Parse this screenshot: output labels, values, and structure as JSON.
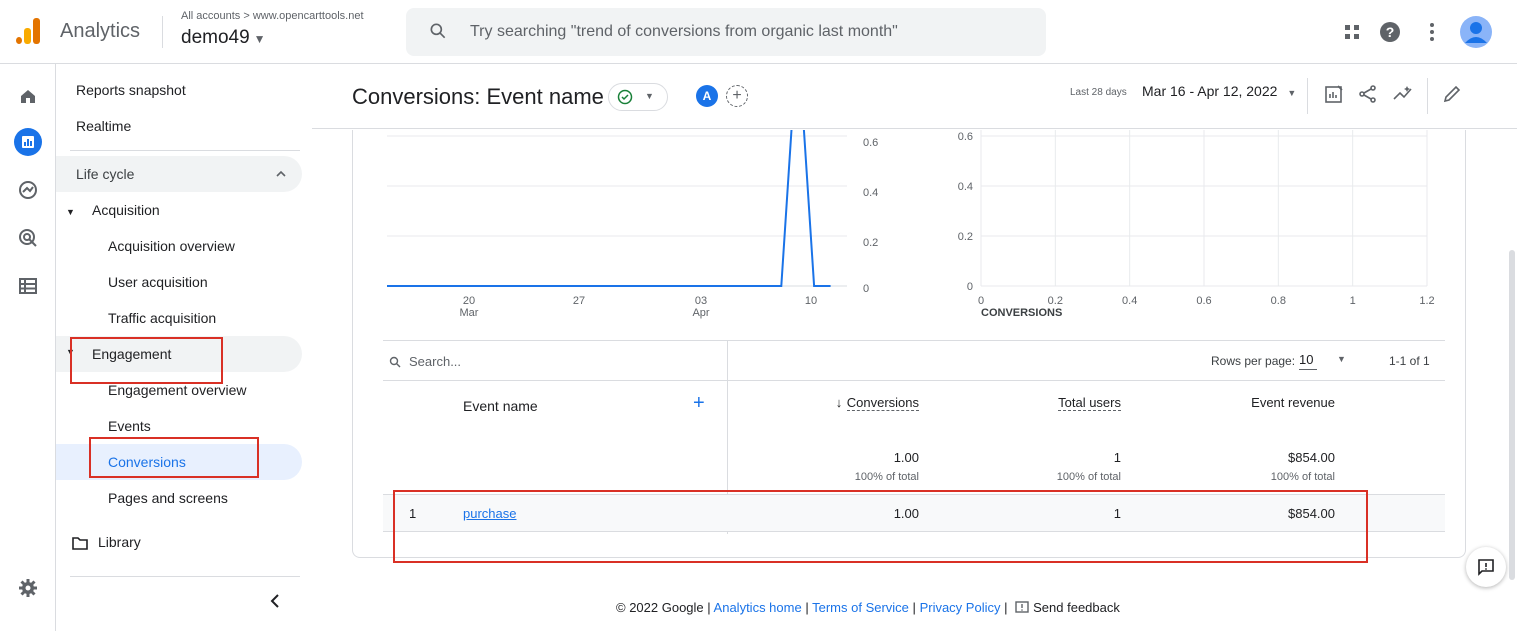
{
  "topbar": {
    "app_name": "Analytics",
    "breadcrumb": "All accounts > www.opencarttools.net",
    "account": "demo49",
    "search_placeholder": "Try searching \"trend of conversions from organic last month\""
  },
  "sidebar": {
    "reports_snapshot": "Reports snapshot",
    "realtime": "Realtime",
    "life_cycle": "Life cycle",
    "acquisition": "Acquisition",
    "acquisition_items": [
      "Acquisition overview",
      "User acquisition",
      "Traffic acquisition"
    ],
    "engagement": "Engagement",
    "engagement_items": [
      "Engagement overview",
      "Events",
      "Conversions",
      "Pages and screens"
    ],
    "library": "Library"
  },
  "header": {
    "title": "Conversions: Event name",
    "comparison_avatar": "A",
    "date_range_label": "Last 28 days",
    "date_range": "Mar 16 - Apr 12, 2022"
  },
  "chart_data": [
    {
      "type": "line",
      "x_tick_labels": [
        "20\nMar",
        "27",
        "03\nApr",
        "10"
      ],
      "y_tick_labels": [
        "0",
        "0.2",
        "0.4",
        "0.6"
      ],
      "series": [
        {
          "values": [
            0,
            0,
            0,
            0,
            0,
            0,
            0,
            0,
            0,
            0,
            0,
            0,
            0,
            0,
            0,
            0,
            0,
            0,
            0,
            0,
            0,
            0,
            0,
            0,
            0,
            1,
            0,
            0
          ]
        }
      ],
      "ylim": [
        0,
        0.7
      ]
    },
    {
      "type": "scatter",
      "xlabel": "CONVERSIONS",
      "x_tick_labels": [
        "0",
        "0.2",
        "0.4",
        "0.6",
        "0.8",
        "1",
        "1.2"
      ],
      "y_tick_labels": [
        "0",
        "0.2",
        "0.4",
        "0.6"
      ],
      "xlim": [
        0,
        1.2
      ],
      "ylim": [
        0,
        0.6
      ]
    }
  ],
  "table": {
    "search_placeholder": "Search...",
    "rows_per_page_label": "Rows per page:",
    "rows_per_page": "10",
    "pagination": "1-1 of 1",
    "columns": {
      "event_name": "Event name",
      "conversions": "Conversions",
      "total_users": "Total users",
      "event_revenue": "Event revenue"
    },
    "totals": {
      "conversions": "1.00",
      "total_users": "1",
      "event_revenue": "$854.00",
      "pct": "100% of total"
    },
    "rows": [
      {
        "index": "1",
        "event_name": "purchase",
        "conversions": "1.00",
        "total_users": "1",
        "event_revenue": "$854.00"
      }
    ]
  },
  "footer": {
    "copyright": "© 2022 Google |",
    "analytics_home": "Analytics home",
    "terms": "Terms of Service",
    "privacy": "Privacy Policy",
    "sep": "|",
    "feedback": "Send feedback"
  },
  "colors": {
    "accent": "#1a73e8",
    "highlight": "#d93025"
  }
}
